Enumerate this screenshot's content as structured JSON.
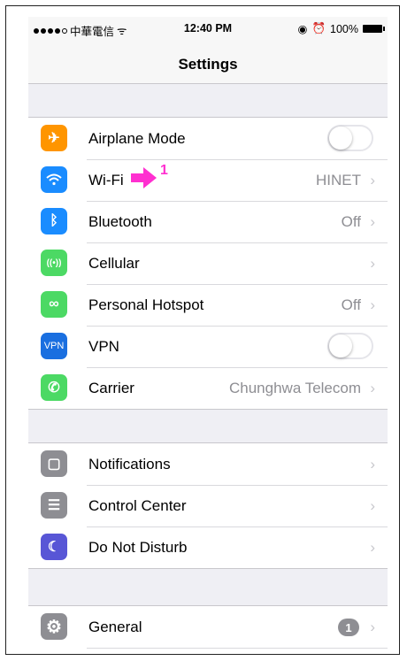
{
  "status_bar": {
    "carrier": "中華電信",
    "wifi_glyph": "ᯤ",
    "time": "12:40 PM",
    "location_glyph": "◉",
    "alarm_glyph": "⏰",
    "battery": "100%"
  },
  "nav": {
    "title": "Settings"
  },
  "groups": [
    {
      "rows": [
        {
          "id": "airplane",
          "label": "Airplane Mode",
          "icon": "airplane-icon",
          "glyph": "✈",
          "color": "#ff9500",
          "toggle": false
        },
        {
          "id": "wifi",
          "label": "Wi-Fi",
          "icon": "wifi-icon",
          "glyph": "◠",
          "color": "#1a8cff",
          "value": "HINET",
          "chevron": "›"
        },
        {
          "id": "bluetooth",
          "label": "Bluetooth",
          "icon": "bluetooth-icon",
          "glyph": "ᛒ",
          "color": "#1a8cff",
          "value": "Off",
          "chevron": "›"
        },
        {
          "id": "cellular",
          "label": "Cellular",
          "icon": "cellular-icon",
          "glyph": "((•))",
          "color": "#4cd964",
          "chevron": "›"
        },
        {
          "id": "hotspot",
          "label": "Personal Hotspot",
          "icon": "hotspot-icon",
          "glyph": "∞",
          "color": "#4cd964",
          "value": "Off",
          "chevron": "›"
        },
        {
          "id": "vpn",
          "label": "VPN",
          "icon": "vpn-icon",
          "glyph": "VPN",
          "color": "#1a6fe0",
          "toggle": false
        },
        {
          "id": "carrier",
          "label": "Carrier",
          "icon": "phone-icon",
          "glyph": "✆",
          "color": "#4cd964",
          "value": "Chunghwa Telecom",
          "chevron": "›"
        }
      ]
    },
    {
      "rows": [
        {
          "id": "notifications",
          "label": "Notifications",
          "icon": "notifications-icon",
          "glyph": "▢",
          "color": "#8e8e93",
          "chevron": "›"
        },
        {
          "id": "control-center",
          "label": "Control Center",
          "icon": "control-center-icon",
          "glyph": "☰",
          "color": "#8e8e93",
          "chevron": "›"
        },
        {
          "id": "dnd",
          "label": "Do Not Disturb",
          "icon": "moon-icon",
          "glyph": "☾",
          "color": "#5856d6",
          "chevron": "›"
        }
      ]
    },
    {
      "rows": [
        {
          "id": "general",
          "label": "General",
          "icon": "gear-icon",
          "glyph": "⚙",
          "color": "#8e8e93",
          "badge": "1",
          "chevron": "›"
        }
      ]
    }
  ],
  "annotation": {
    "number": "1",
    "color": "#ff2fd0"
  }
}
